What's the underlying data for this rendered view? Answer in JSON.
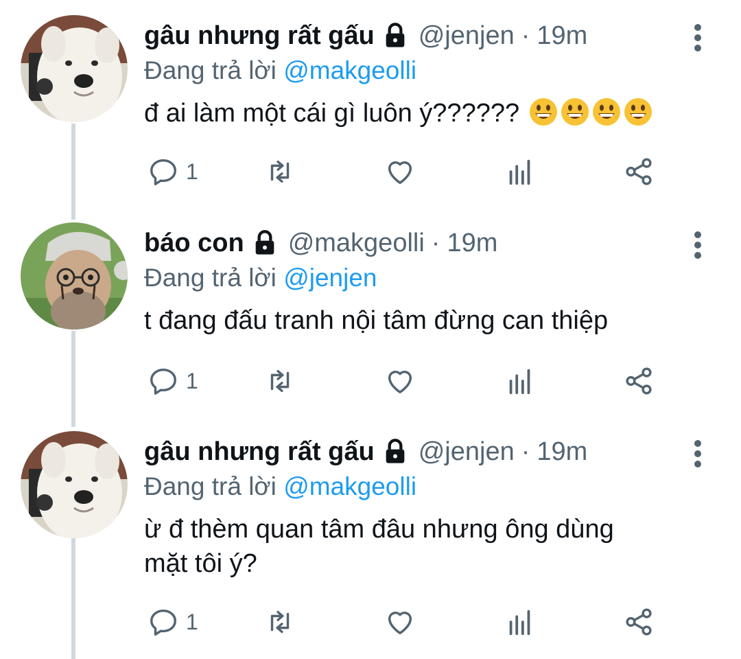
{
  "replying_prefix": "Đang trả lời",
  "tweets": [
    {
      "name": "gâu nhưng rất gấu",
      "handle": "@jenjen",
      "separator": "·",
      "time": "19m",
      "reply_to": "@makgeolli",
      "text": "đ ai làm một cái gì luôn ý??????",
      "emoji": [
        "grinning-face",
        "grinning-face",
        "grinning-face",
        "grinning-face"
      ],
      "reply_count": "1",
      "avatar": "white-dog-avatar"
    },
    {
      "name": "báo con",
      "handle": "@makgeolli",
      "separator": "·",
      "time": "19m",
      "reply_to": "@jenjen",
      "text": "t đang đấu tranh nội tâm đừng can thiệp",
      "reply_count": "1",
      "avatar": "cheetah-cub-avatar"
    },
    {
      "name": "gâu nhưng rất gấu",
      "handle": "@jenjen",
      "separator": "·",
      "time": "19m",
      "reply_to": "@makgeolli",
      "text": "ừ đ thèm quan tâm đâu nhưng ông dùng\nmặt tôi ý?",
      "reply_count": "1",
      "avatar": "white-dog-avatar"
    }
  ],
  "colors": {
    "text": "#0f1419",
    "secondary": "#536471",
    "accent": "#1d9bf0",
    "thread_line": "#cfd9de"
  }
}
